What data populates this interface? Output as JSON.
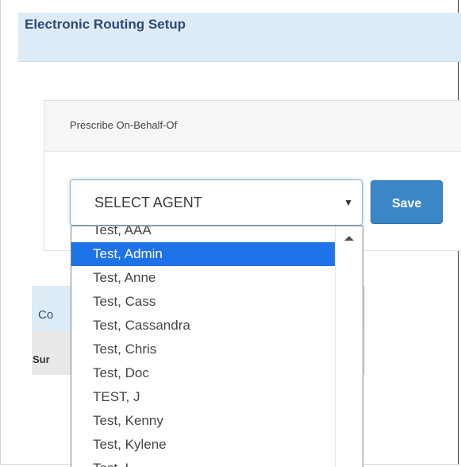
{
  "header": {
    "title": "Electronic Routing Setup"
  },
  "panel": {
    "heading": "Prescribe On-Behalf-Of",
    "select": {
      "value": "SELECT AGENT",
      "arrow_icon": "triangle-down-icon"
    },
    "save_label": "Save"
  },
  "dropdown": {
    "options": [
      "Test, AAA",
      "Test, Admin",
      "Test, Anne",
      "Test, Cass",
      "Test, Cassandra",
      "Test, Chris",
      "Test, Doc",
      "TEST, J",
      "Test, Kenny",
      "Test, Kylene",
      "Test, L"
    ],
    "selected_index": 1,
    "scroll_icon": "scroll-up-icon"
  },
  "background_section": {
    "heading_partial": "Co",
    "subheading_partial": "Sur"
  },
  "colors": {
    "header_bg": "#dcebf5",
    "title_text": "#2d4a73",
    "save_button": "#3a86c7",
    "selected_option": "#1e73e8"
  }
}
